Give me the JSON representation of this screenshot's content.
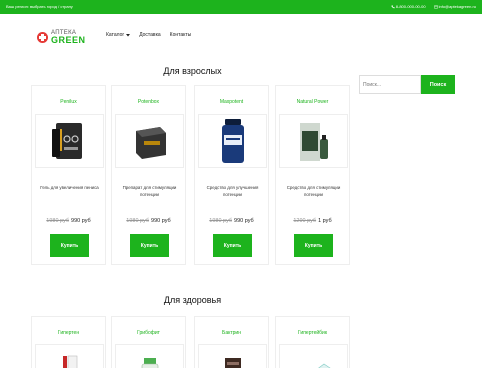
{
  "topbar": {
    "city_text": "Ваш регион: выбрать город / страну",
    "phone": "8-800-000-00-00",
    "email": "info@aptekagreen.ru"
  },
  "logo": {
    "line1": "АПТЕКА",
    "line2": "GREEN"
  },
  "nav": {
    "catalog": "Каталог",
    "delivery": "Доставка",
    "contacts": "Контакты"
  },
  "sections": {
    "adults_title": "Для взрослых",
    "health_title": "Для здоровья"
  },
  "adult_products": [
    {
      "name": "Penilux",
      "desc": "Гель для увеличения пениса",
      "old_price": "1980 руб",
      "price": "990 руб",
      "buy": "Купить"
    },
    {
      "name": "Potenbox",
      "desc": "Препарат для стимуляции потенции",
      "old_price": "1980 руб",
      "price": "990 руб",
      "buy": "Купить"
    },
    {
      "name": "Maxpotent",
      "desc": "Средство для улучшения потенции",
      "old_price": "1980 руб",
      "price": "990 руб",
      "buy": "Купить"
    },
    {
      "name": "Natural Power",
      "desc": "Средство для стимуляции потенции",
      "old_price": "1290 руб",
      "price": "1 руб",
      "buy": "Купить"
    }
  ],
  "health_products": [
    {
      "name": "Гипертен"
    },
    {
      "name": "Грибофит"
    },
    {
      "name": "Бактрин"
    },
    {
      "name": "Гипертейбик"
    }
  ],
  "search": {
    "placeholder": "Поиск...",
    "button": "Поиск"
  },
  "colors": {
    "accent": "#1db31d",
    "logo_cross": "#e53935"
  }
}
